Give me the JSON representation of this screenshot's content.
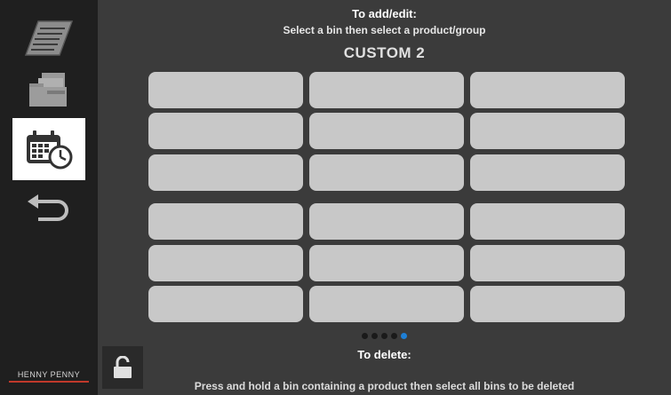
{
  "header": {
    "instruction_title": "To add/edit:",
    "instruction_text": "Select a bin then select a product/group",
    "screen_title": "CUSTOM 2"
  },
  "sidebar": {
    "items": [
      {
        "name": "recipes-icon",
        "active": false
      },
      {
        "name": "folders-icon",
        "active": false
      },
      {
        "name": "schedule-icon",
        "active": true
      },
      {
        "name": "back-icon",
        "active": false
      }
    ],
    "brand": "HENNY PENNY"
  },
  "bins": {
    "rows": 6,
    "columns": 3,
    "count": 18
  },
  "pagination": {
    "total": 5,
    "current": 5
  },
  "footer": {
    "delete_title": "To delete:",
    "delete_text": "Press and hold a bin containing a product then select all bins to be deleted"
  },
  "colors": {
    "background": "#3b3b3b",
    "sidebar": "#1f1f1f",
    "bin": "#c8c8c8",
    "active_dot": "#1e7fd6"
  }
}
